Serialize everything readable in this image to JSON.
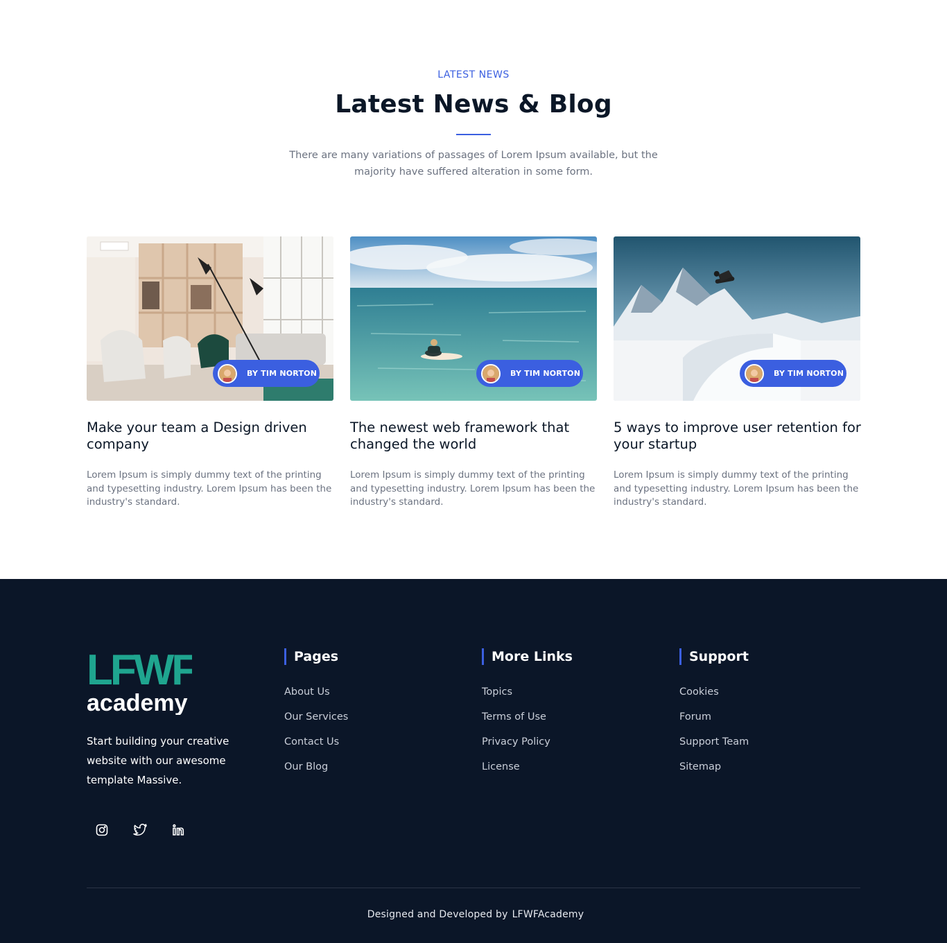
{
  "section": {
    "eyebrow": "LATEST NEWS",
    "title": "Latest News & Blog",
    "intro": "There are many variations of passages of Lorem Ipsum available, but the majority have suffered alteration in some form."
  },
  "posts": [
    {
      "author": "BY TIM NORTON",
      "title": "Make your team a Design driven company",
      "excerpt": "Lorem Ipsum is simply dummy text of the printing and typesetting industry. Lorem Ipsum has been the industry's standard."
    },
    {
      "author": "BY TIM NORTON",
      "title": "The newest web framework that changed the world",
      "excerpt": "Lorem Ipsum is simply dummy text of the printing and typesetting industry. Lorem Ipsum has been the industry's standard."
    },
    {
      "author": "BY TIM NORTON",
      "title": "5 ways to improve user retention for your startup",
      "excerpt": "Lorem Ipsum is simply dummy text of the printing and typesetting industry. Lorem Ipsum has been the industry's standard."
    }
  ],
  "footer": {
    "logo_line1": "LFWF",
    "logo_line2": "academy",
    "tagline": "Start building your creative website with our awesome template Massive.",
    "socials": [
      "instagram-icon",
      "twitter-icon",
      "linkedin-icon"
    ],
    "columns": [
      {
        "heading": "Pages",
        "links": [
          "About Us",
          "Our Services",
          "Contact Us",
          "Our Blog"
        ]
      },
      {
        "heading": "More Links",
        "links": [
          "Topics",
          "Terms of Use",
          "Privacy Policy",
          "License"
        ]
      },
      {
        "heading": "Support",
        "links": [
          "Cookies",
          "Forum",
          "Support Team",
          "Sitemap"
        ]
      }
    ],
    "credit_prefix": "Designed and Developed by",
    "credit_brand": "LFWFAcademy"
  },
  "colors": {
    "accent": "#3b5fe0",
    "footer_bg": "#0b1628",
    "logo_teal": "#1fa58f",
    "heading": "#0b1727",
    "body_text": "#6b7280"
  }
}
